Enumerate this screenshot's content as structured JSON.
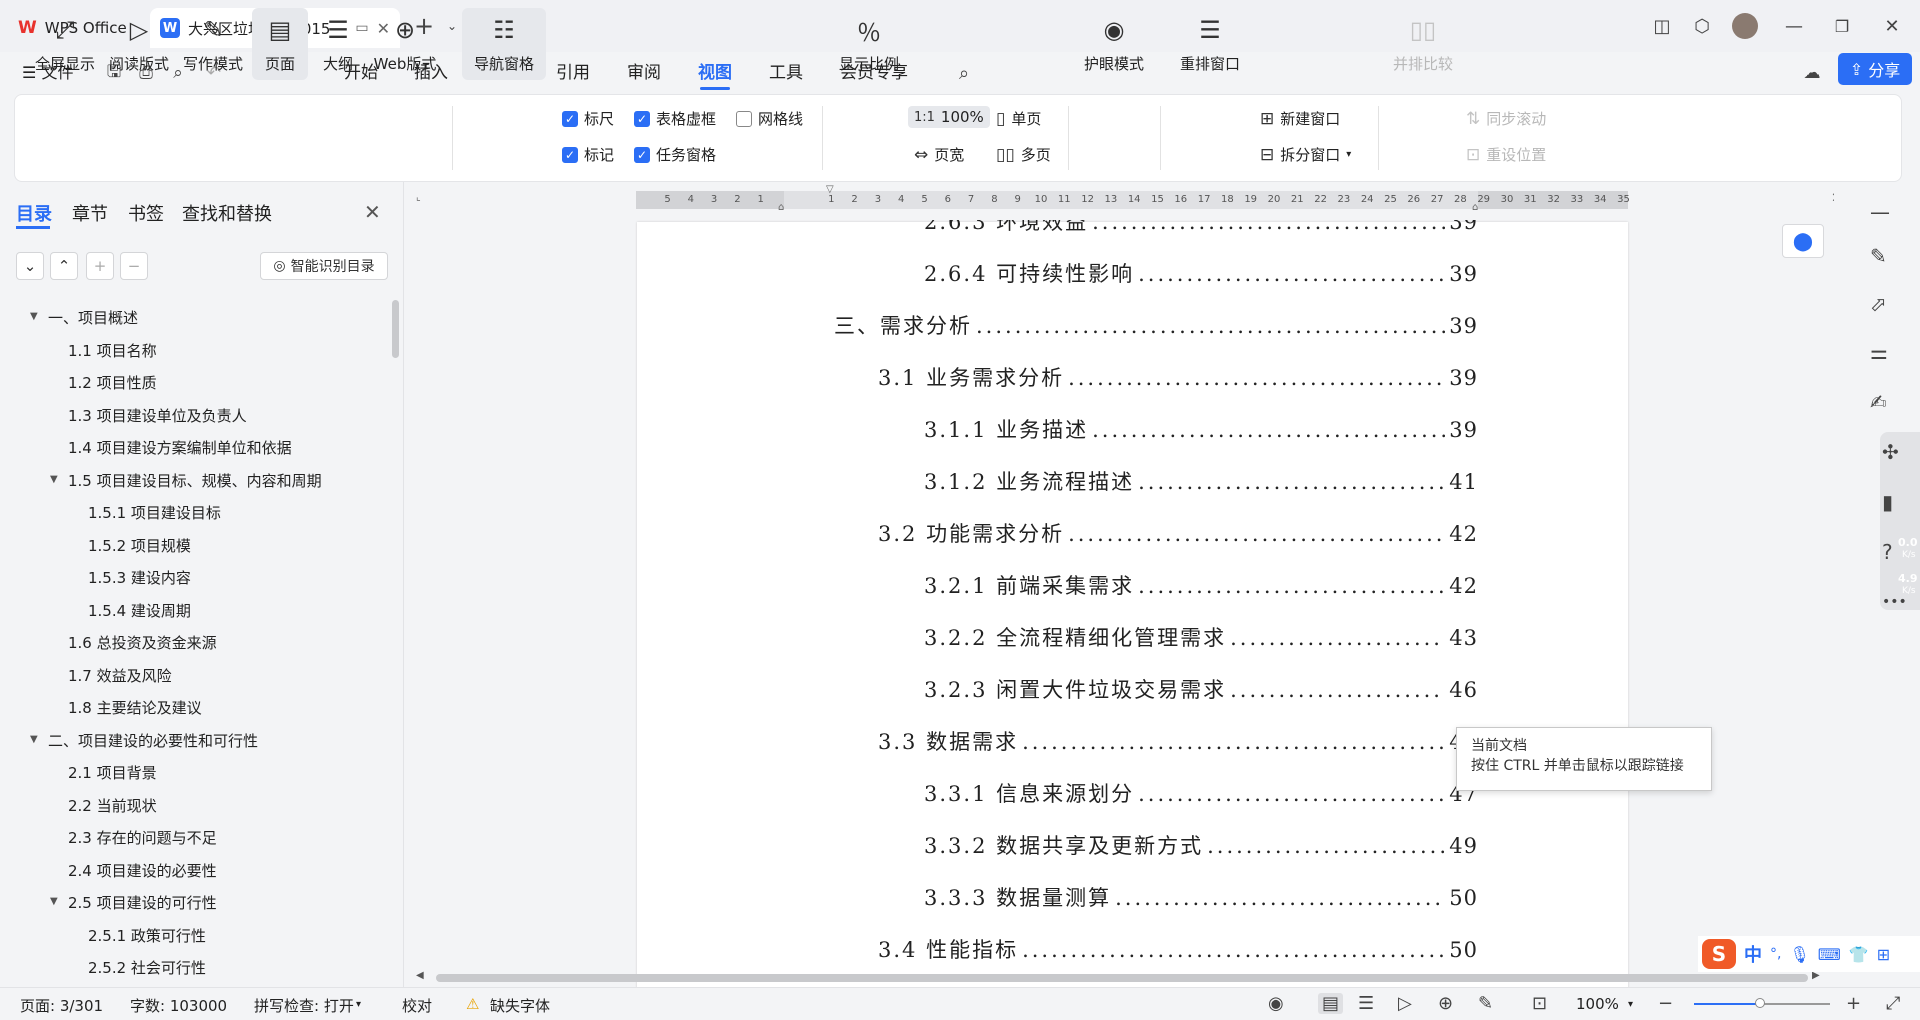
{
  "titlebar": {
    "app_tab": "WPS Office",
    "doc_tab": "大兴区垃圾...案1015",
    "new_tab": "+"
  },
  "menu": {
    "file": "文件",
    "items": [
      "开始",
      "插入",
      "页面",
      "引用",
      "审阅",
      "视图",
      "工具",
      "会员专享"
    ],
    "active": "视图",
    "share": "分享"
  },
  "ribbon": {
    "fullscreen": "全屏显示",
    "reading": "阅读版式",
    "writing": "写作模式",
    "page": "页面",
    "outline": "大纲",
    "web": "Web版式",
    "nav_pane": "导航窗格",
    "ruler": "标尺",
    "table_grid": "表格虚框",
    "gridlines": "网格线",
    "marks": "标记",
    "task_pane": "任务窗格",
    "zoom_ratio": "显示比例",
    "zoom_100": "100%",
    "single_page": "单页",
    "page_width": "页宽",
    "multi_page": "多页",
    "eye_care": "护眼模式",
    "rearrange": "重排窗口",
    "new_window": "新建窗口",
    "split_window": "拆分窗口",
    "side_by_side": "并排比较",
    "sync_scroll": "同步滚动",
    "reset_pos": "重设位置"
  },
  "leftpanel": {
    "tabs": [
      "目录",
      "章节",
      "书签",
      "查找和替换"
    ],
    "active_tab": "目录",
    "smart_toc": "智能识别目录",
    "toc": [
      {
        "label": "一、项目概述",
        "level": 0,
        "expanded": true
      },
      {
        "label": "1.1  项目名称",
        "level": 1
      },
      {
        "label": "1.2  项目性质",
        "level": 1
      },
      {
        "label": "1.3  项目建设单位及负责人",
        "level": 1
      },
      {
        "label": "1.4  项目建设方案编制单位和依据",
        "level": 1
      },
      {
        "label": "1.5  项目建设目标、规模、内容和周期",
        "level": 1,
        "expanded": true
      },
      {
        "label": "1.5.1  项目建设目标",
        "level": 2
      },
      {
        "label": "1.5.2  项目规模",
        "level": 2
      },
      {
        "label": "1.5.3  建设内容",
        "level": 2
      },
      {
        "label": "1.5.4  建设周期",
        "level": 2
      },
      {
        "label": "1.6  总投资及资金来源",
        "level": 1
      },
      {
        "label": "1.7  效益及风险",
        "level": 1
      },
      {
        "label": "1.8  主要结论及建议",
        "level": 1
      },
      {
        "label": "二、项目建设的必要性和可行性",
        "level": 0,
        "expanded": true
      },
      {
        "label": "2.1  项目背景",
        "level": 1
      },
      {
        "label": "2.2  当前现状",
        "level": 1
      },
      {
        "label": "2.3  存在的问题与不足",
        "level": 1
      },
      {
        "label": "2.4  项目建设的必要性",
        "level": 1
      },
      {
        "label": "2.5  项目建设的可行性",
        "level": 1,
        "expanded": true
      },
      {
        "label": "2.5.1  政策可行性",
        "level": 2
      },
      {
        "label": "2.5.2  社会可行性",
        "level": 2
      }
    ]
  },
  "ruler": {
    "left_numbers": [
      "5",
      "4",
      "3",
      "2",
      "1"
    ],
    "right_numbers": [
      "1",
      "2",
      "3",
      "4",
      "5",
      "6",
      "7",
      "8",
      "9",
      "10",
      "11",
      "12",
      "13",
      "14",
      "15",
      "16",
      "17",
      "18",
      "19",
      "20",
      "21",
      "22",
      "23",
      "24",
      "25",
      "26",
      "27",
      "28",
      "29",
      "30",
      "31",
      "32",
      "33",
      "34",
      "35"
    ]
  },
  "document": {
    "lines": [
      {
        "text": "2.6.3 环境效益",
        "page": "39",
        "indent": 2
      },
      {
        "text": "2.6.4 可持续性影响",
        "page": "39",
        "indent": 2
      },
      {
        "text": "三、需求分析",
        "page": "39",
        "indent": 0
      },
      {
        "text": "3.1 业务需求分析",
        "page": "39",
        "indent": 1
      },
      {
        "text": "3.1.1  业务描述",
        "page": "39",
        "indent": 2
      },
      {
        "text": "3.1.2  业务流程描述",
        "page": "41",
        "indent": 2
      },
      {
        "text": "3.2 功能需求分析",
        "page": "42",
        "indent": 1
      },
      {
        "text": "3.2.1  前端采集需求",
        "page": "42",
        "indent": 2
      },
      {
        "text": "3.2.2  全流程精细化管理需求",
        "page": "43",
        "indent": 2
      },
      {
        "text": "3.2.3  闲置大件垃圾交易需求",
        "page": "46",
        "indent": 2
      },
      {
        "text": "3.3 数据需求",
        "page": "47",
        "indent": 1
      },
      {
        "text": "3.3.1  信息来源划分",
        "page": "47",
        "indent": 2
      },
      {
        "text": "3.3.2  数据共享及更新方式",
        "page": "49",
        "indent": 2
      },
      {
        "text": "3.3.3  数据量测算",
        "page": "50",
        "indent": 2
      },
      {
        "text": "3.4 性能指标",
        "page": "50",
        "indent": 1
      }
    ],
    "tooltip_title": "当前文档",
    "tooltip_body": "按住 CTRL 并单击鼠标以跟踪链接"
  },
  "rightrail": {
    "net_up": "0.0",
    "net_up_unit": "K/s",
    "net_down": "4.9",
    "net_down_unit": "K/s"
  },
  "status": {
    "page": "页面: 3/301",
    "words": "字数: 103000",
    "spell": "拼写检查: 打开",
    "proof": "校对",
    "missing_font": "缺失字体",
    "zoom": "100%"
  },
  "ime": {
    "lang": "中",
    "punct": "°,"
  },
  "colors": {
    "accent": "#2b6ef5",
    "wps_red": "#e8322d"
  }
}
